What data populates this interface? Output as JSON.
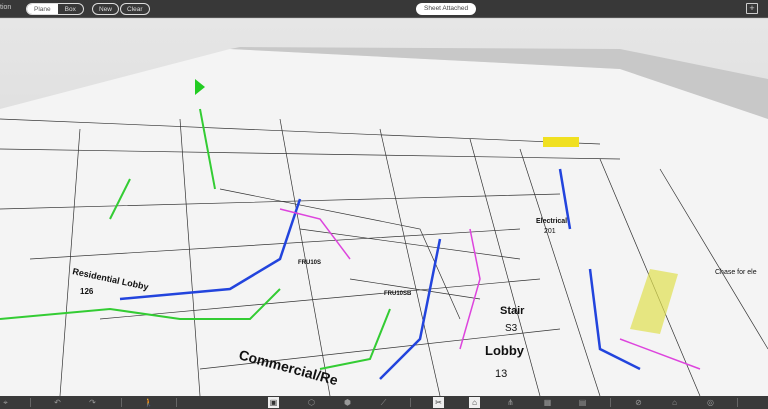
{
  "topbar": {
    "left_label": "tion",
    "mode_options": [
      {
        "label": "Plane",
        "selected": true
      },
      {
        "label": "Box",
        "selected": false
      }
    ],
    "new_label": "New",
    "clear_label": "Clear",
    "status_label": "Sheet Attached"
  },
  "drawing": {
    "labels": [
      "Residential Lobby",
      "126",
      "Stair",
      "S3",
      "Lobby",
      "13",
      "Commercial/Re",
      "Electrical",
      "201",
      "FRU10S",
      "FRU10SB",
      "Chase for ele"
    ]
  },
  "bottombar": {
    "icons": [
      "location-icon",
      "undo-icon",
      "redo-icon",
      "walk-icon",
      "section-box-icon",
      "cube-icon",
      "cube-outline-icon",
      "measure-icon",
      "scissors-icon",
      "home-box-icon",
      "hierarchy-icon",
      "grid-icon",
      "sheet-icon",
      "eye-off-icon",
      "home-icon",
      "focus-icon"
    ],
    "active": [
      "section-box-icon",
      "scissors-icon",
      "home-box-icon"
    ]
  },
  "colors": {
    "topbar": "#383838",
    "pipe_blue": "#2244dd",
    "pipe_green": "#33cc33",
    "pipe_magenta": "#dd44dd",
    "highlight_yellow": "#f0e020"
  }
}
